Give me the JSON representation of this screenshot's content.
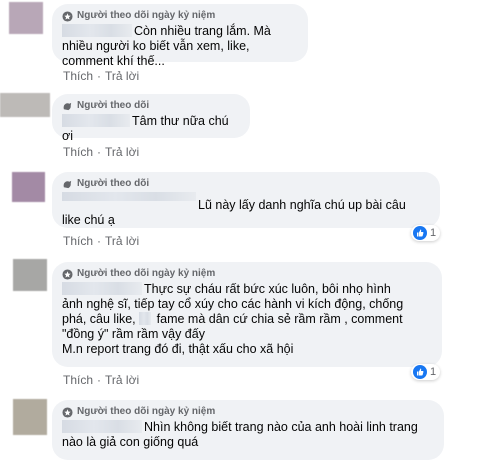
{
  "comments": [
    {
      "badge": "Người theo dõi ngày kỷ niệm",
      "text": "Còn nhiều trang lắm. Mà nhiều người ko biết vẫn xem, like, comment khí thế...",
      "actions": {
        "like": "Thích",
        "reply": "Trả lời"
      },
      "avatar_color": "#b8a7b7"
    },
    {
      "badge": "Người theo dõi",
      "text": "Tâm thư nữa chú ơi",
      "actions": {
        "like": "Thích",
        "reply": "Trả lời"
      },
      "avatar_color": "#bdbab7"
    },
    {
      "badge": "Người theo dõi",
      "text_line1": "Lũ này lấy danh nghĩa chú up bài câu",
      "text_line2": "like chú ạ",
      "actions": {
        "like": "Thích",
        "reply": "Trả lời"
      },
      "likes": "1",
      "avatar_color": "#a38aa5"
    },
    {
      "badge": "Người theo dõi ngày kỷ niệm",
      "text_line1": "Thực sự cháu rất bức xúc luôn, bôi nhọ hình",
      "text_line2": "ảnh nghệ sĩ, tiếp tay cổ xúy cho các hành vi kích động, chống",
      "text_line3a": "phá, câu like,",
      "text_line3b": "fame mà dân cứ chia sẻ rầm rầm , comment",
      "text_line4": "\"đồng ý\" rầm rầm vậy đấy",
      "text_line5": "M.n report trang đó đi, thật xấu cho xã hội",
      "actions": {
        "like": "Thích",
        "reply": "Trả lời"
      },
      "likes": "1",
      "avatar_color": "#a7a7a5"
    },
    {
      "badge": "Người theo dõi ngày kỷ niệm",
      "text_line1": "Nhìn không biết trang nào của anh hoài linh trang",
      "text_line2": "nào là giả con giống quá",
      "avatar_color": "#b1ab9e"
    }
  ],
  "colors": {
    "bubble": "#f0f2f5",
    "secondary_text": "#65676b",
    "like_blue": "#1877f2"
  },
  "icons": {
    "badge": "fan-badge-icon",
    "like": "thumbs-up-icon"
  }
}
